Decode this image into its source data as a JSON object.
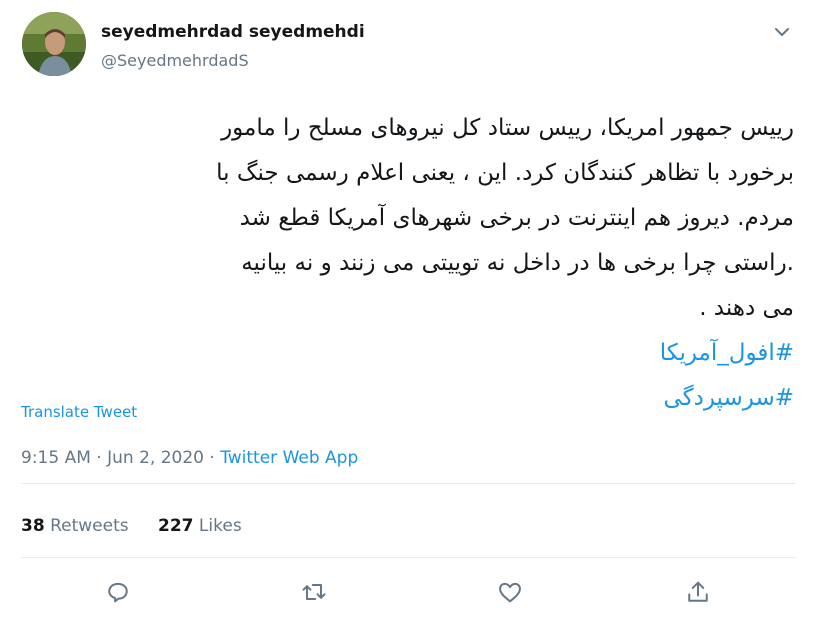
{
  "author": {
    "display_name": "seyedmehrdad seyedmehdi",
    "handle": "@SeyedmehrdadS",
    "avatar_icon": "avatar-photo-icon"
  },
  "tweet": {
    "lines": [
      "رییس جمهور امریکا، رییس ستاد کل نیروهای مسلح را مامور",
      "برخورد با تظاهر کنندگان کرد. این ، یعنی اعلام رسمی جنگ با",
      "مردم. دیروز هم اینترنت در برخی شهرهای آمریکا قطع شد",
      ".راستی چرا برخی ها در داخل   نه توییتی می زنند و نه بیانیه",
      "می دهند ."
    ],
    "hashtags": [
      "#افول_آمریکا",
      "#سرسپردگی"
    ],
    "translate_label": "Translate Tweet"
  },
  "meta": {
    "time": "9:15 AM",
    "separator": "·",
    "date": "Jun 2, 2020",
    "app": "Twitter Web App"
  },
  "stats": {
    "retweets_count": "38",
    "retweets_label": "Retweets",
    "likes_count": "227",
    "likes_label": "Likes"
  },
  "actions": [
    "reply-icon",
    "retweet-icon",
    "like-icon",
    "share-icon"
  ],
  "colors": {
    "link": "#1b95e0",
    "secondary_text": "#657786",
    "divider": "#e6ecf0"
  }
}
